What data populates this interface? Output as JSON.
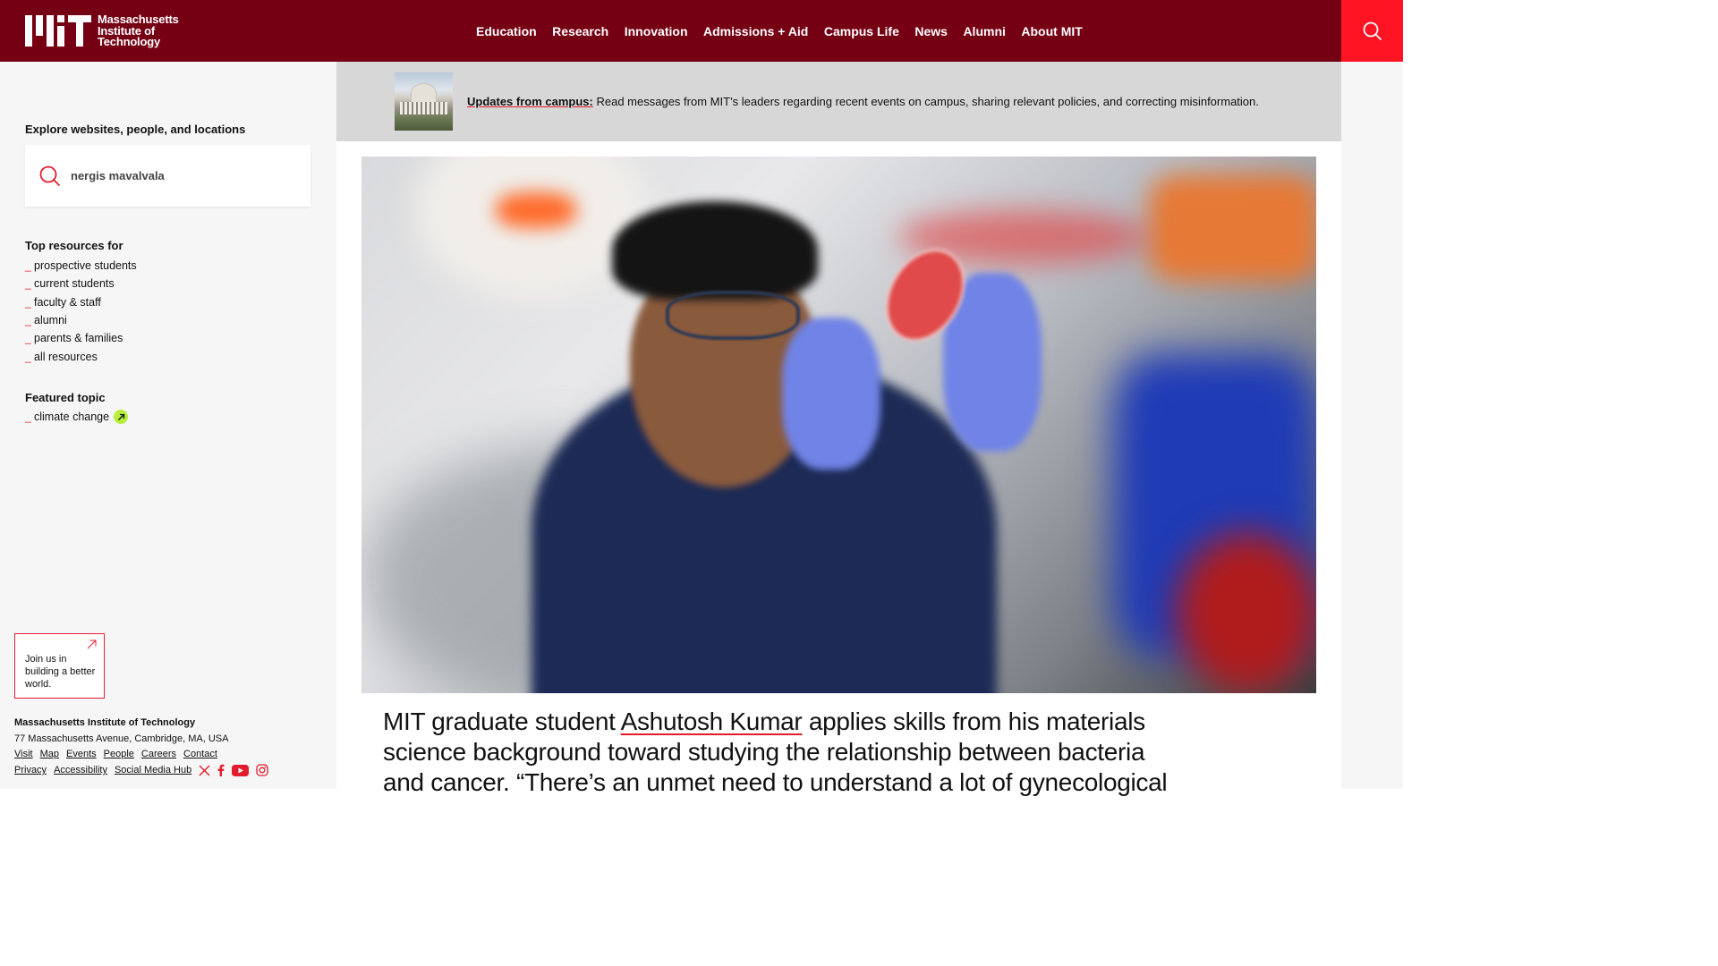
{
  "header": {
    "logo_lines": [
      "Massachusetts",
      "Institute of",
      "Technology"
    ],
    "nav": [
      "Education",
      "Research",
      "Innovation",
      "Admissions + Aid",
      "Campus Life",
      "News",
      "Alumni",
      "About MIT"
    ],
    "bg_color": "#750014",
    "search_color": "#ff1423"
  },
  "sidebar": {
    "explore_label": "Explore websites, people, and locations",
    "search_value": "nergis mavalvala",
    "resources_title": "Top resources for",
    "resources": [
      "prospective students",
      "current students",
      "faculty & staff",
      "alumni",
      "parents & families",
      "all resources"
    ],
    "featured_title": "Featured topic",
    "featured": "climate change",
    "join_text": "Join us in building a better world.",
    "footer": {
      "name": "Massachusetts Institute of Technology",
      "address": "77 Massachusetts Avenue, Cambridge, MA, USA",
      "links_row1": [
        "Visit",
        "Map",
        "Events",
        "People",
        "Careers",
        "Contact"
      ],
      "links_row2": [
        "Privacy",
        "Accessibility",
        "Social Media Hub"
      ],
      "social_icons": [
        "x-icon",
        "facebook-icon",
        "youtube-icon",
        "instagram-icon"
      ]
    }
  },
  "alert": {
    "link": "Updates from campus:",
    "text": " Read messages from MIT’s leaders regarding recent events on campus, sharing relevant policies, and correcting misinformation."
  },
  "hero": {
    "headline_pre": "MIT graduate student ",
    "headline_name": "Ashutosh Kumar",
    "headline_post": " applies skills from his materials science background toward studying the relationship between bacteria and cancer. “There’s an unmet need to understand a lot of gynecological"
  }
}
